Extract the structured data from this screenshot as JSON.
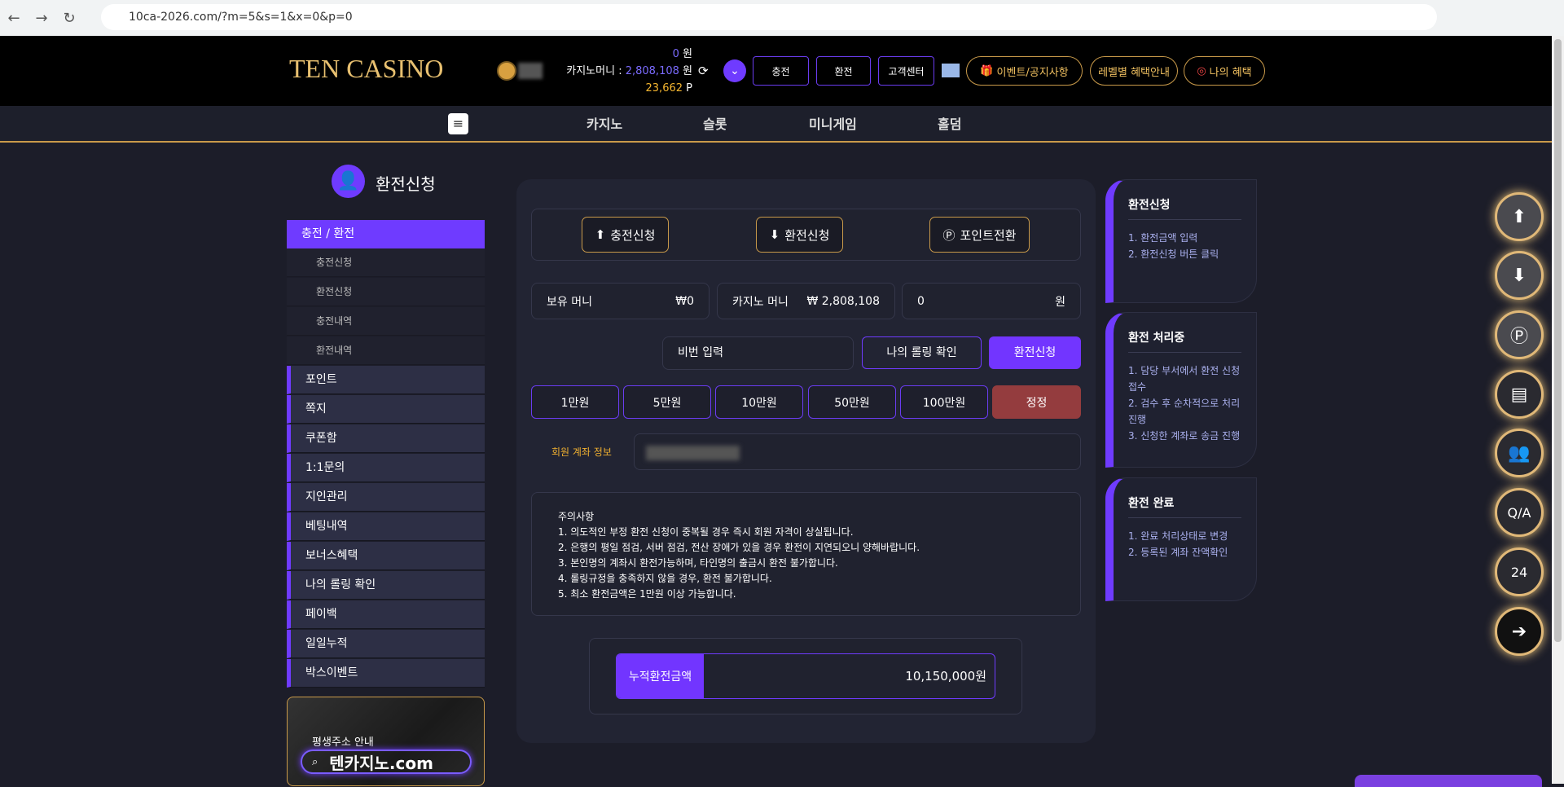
{
  "browser": {
    "url": "10ca-2026.com/?m=5&s=1&x=0&p=0"
  },
  "header": {
    "logo": "TEN CASINO",
    "balance_won": "0",
    "won_unit": "원",
    "casino_money_label": "카지노머니 :",
    "casino_money": "2,808,108",
    "points": "23,662",
    "points_unit": "P",
    "buttons": [
      "충전",
      "환전",
      "고객센터"
    ],
    "gold_buttons": [
      "이벤트/공지사항",
      "레벨별 혜택안내",
      "나의 혜택"
    ]
  },
  "nav": [
    "카지노",
    "슬롯",
    "미니게임",
    "홀덤"
  ],
  "sidebar": {
    "title": "환전신청",
    "active": "충전 / 환전",
    "subs": [
      "충전신청",
      "환전신청",
      "충전내역",
      "환전내역"
    ],
    "items": [
      "포인트",
      "쪽지",
      "쿠폰함",
      "1:1문의",
      "지인관리",
      "베팅내역",
      "보너스혜택",
      "나의 롤링 확인",
      "페이백",
      "일일누적",
      "박스이벤트"
    ],
    "banner": {
      "title": "평생주소 안내",
      "domain": "텐카지노.com"
    }
  },
  "main": {
    "tabs": [
      "충전신청",
      "환전신청",
      "포인트전환"
    ],
    "held_label": "보유 머니",
    "held_value": "₩0",
    "casino_label": "카지노 머니",
    "casino_value": "₩ 2,808,108",
    "amount_value": "0",
    "amount_unit": "원",
    "password_placeholder": "비번 입력",
    "rolling_button": "나의 롤링 확인",
    "submit_button": "환전신청",
    "amounts": [
      "1만원",
      "5만원",
      "10만원",
      "50만원",
      "100만원"
    ],
    "reset_button": "정정",
    "account_label": "회원 계좌 정보",
    "notice_title": "주의사항",
    "notices": [
      "1. 의도적인 부정 환전 신청이 중복될 경우 즉시 회원 자격이 상실됩니다.",
      "2. 은행의 평일 점검, 서버 점검, 전산 장애가 있을 경우 환전이 지연되오니 양해바랍니다.",
      "3. 본인명의 계좌시 환전가능하며, 타인명의 출금시 환전 불가합니다.",
      "4. 롤링규정을 충족하지 않을 경우, 환전 불가합니다.",
      "5. 최소 환전금액은 1만원 이상 가능합니다."
    ],
    "total_label": "누적환전금액",
    "total_value": "10,150,000원"
  },
  "cards": [
    {
      "title": "환전신청",
      "lines": [
        "1. 환전금액 입력",
        "2. 환전신청 버튼 클릭"
      ]
    },
    {
      "title": "환전 처리중",
      "lines": [
        "1. 담당 부서에서 환전 신청 접수",
        "2. 검수 후 순차적으로 처리진행",
        "3. 신청한 계좌로 송금 진행"
      ]
    },
    {
      "title": "환전 완료",
      "lines": [
        "1. 완료 처리상태로 변경",
        "2. 등록된 계좌 잔액확인"
      ]
    }
  ]
}
